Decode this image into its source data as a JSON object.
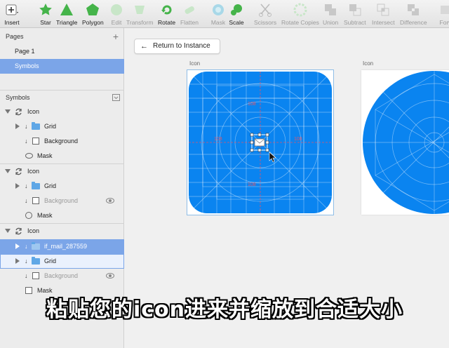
{
  "toolbar": {
    "insert": "Insert",
    "star": "Star",
    "triangle": "Triangle",
    "polygon": "Polygon",
    "edit": "Edit",
    "transform": "Transform",
    "rotate": "Rotate",
    "flatten": "Flatten",
    "mask": "Mask",
    "scale": "Scale",
    "scissors": "Scissors",
    "rotate_copies": "Rotate Copies",
    "union": "Union",
    "subtract": "Subtract",
    "intersect": "Intersect",
    "difference": "Difference",
    "forward": "Forw"
  },
  "pages": {
    "header": "Pages",
    "add": "+",
    "items": [
      "Page 1",
      "Symbols"
    ]
  },
  "layers": {
    "header": "Symbols",
    "groups": [
      {
        "name": "Icon",
        "children": [
          "Grid",
          "Background",
          "Mask"
        ]
      },
      {
        "name": "Icon",
        "children": [
          "Grid",
          "Background",
          "Mask"
        ]
      },
      {
        "name": "Icon",
        "children": [
          "if_mail_287559",
          "Grid",
          "Background",
          "Mask"
        ]
      }
    ]
  },
  "canvas": {
    "return_button": "Return to Instance",
    "artboard1_label": "Icon",
    "artboard2_label": "Icon",
    "accent": "#0a84f0",
    "grid_color": "#ffffff"
  },
  "subtitle": "粘贴您的icon进来并缩放到合适大小"
}
